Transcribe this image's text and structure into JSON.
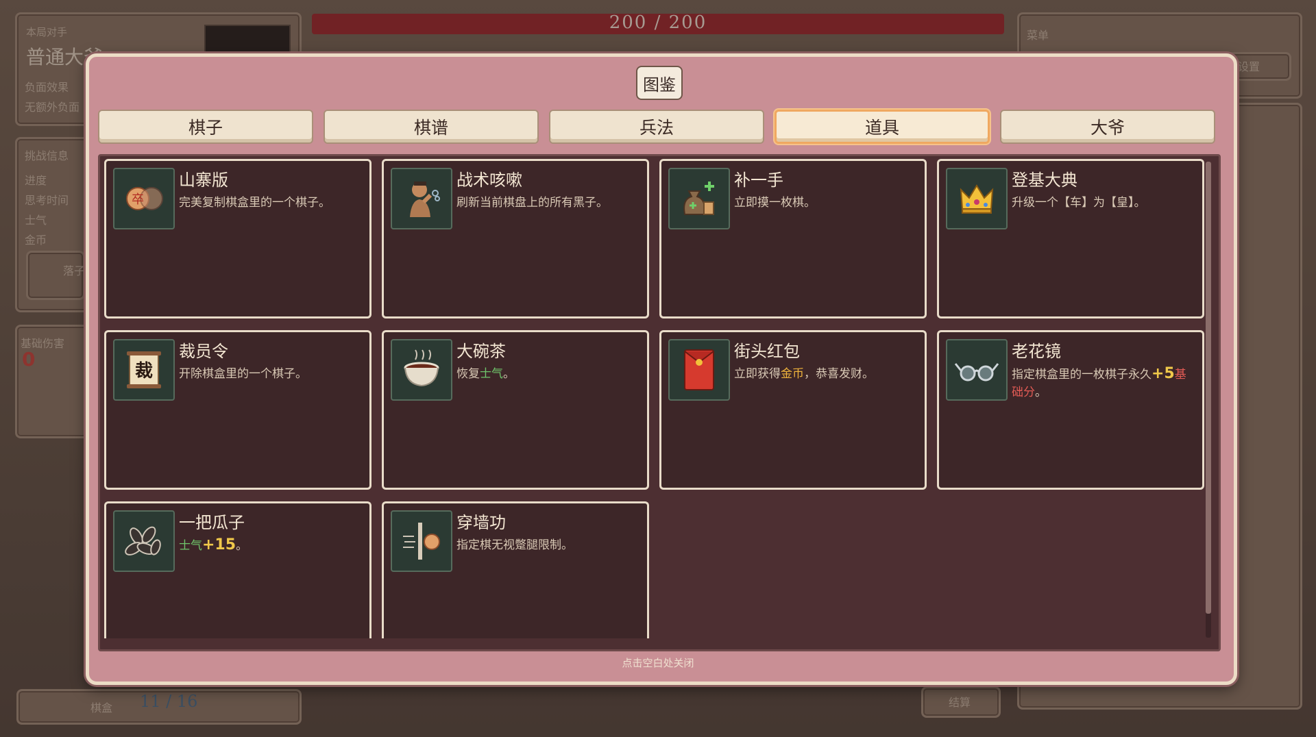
{
  "background": {
    "opponent_label": "本局对手",
    "opponent_name": "普通大爷",
    "negative_effects": "负面效果",
    "no_extra_effects": "无额外负面",
    "challenge_info": "挑战信息",
    "progress_label": "进度",
    "think_time_label": "思考时间",
    "morale_label": "士气",
    "gold_label": "金币",
    "drop_button": "落子",
    "base_damage_label": "基础伤害",
    "base_damage_value": "0",
    "hp_text": "200 / 200",
    "menu_label": "菜单",
    "menu_button": "设置",
    "board_label": "棋盒",
    "board_count": "11 / 16",
    "end_button": "结算"
  },
  "dialog": {
    "title": "图鉴",
    "tabs": [
      {
        "label": "棋子",
        "active": false
      },
      {
        "label": "棋谱",
        "active": false
      },
      {
        "label": "兵法",
        "active": false
      },
      {
        "label": "道具",
        "active": true
      },
      {
        "label": "大爷",
        "active": false
      }
    ],
    "items": [
      {
        "title": "山寨版",
        "icon": "copy-pawn-icon",
        "desc_parts": [
          {
            "t": "完美复制棋盒里的一个棋子。"
          }
        ]
      },
      {
        "title": "战术咳嗽",
        "icon": "coughing-man-icon",
        "desc_parts": [
          {
            "t": "刷新当前棋盘上的所有黑子。"
          }
        ]
      },
      {
        "title": "补一手",
        "icon": "money-bag-icon",
        "desc_parts": [
          {
            "t": "立即摸一枚棋。"
          }
        ]
      },
      {
        "title": "登基大典",
        "icon": "crown-icon",
        "desc_parts": [
          {
            "t": "升级一个【车】为【皇】。"
          }
        ]
      },
      {
        "title": "裁员令",
        "icon": "dismiss-scroll-icon",
        "icon_char": "裁",
        "desc_parts": [
          {
            "t": "开除棋盒里的一个棋子。"
          }
        ]
      },
      {
        "title": "大碗茶",
        "icon": "tea-bowl-icon",
        "desc_parts": [
          {
            "t": "恢复"
          },
          {
            "t": "士气",
            "c": "green"
          },
          {
            "t": "。"
          }
        ]
      },
      {
        "title": "街头红包",
        "icon": "red-envelope-icon",
        "desc_parts": [
          {
            "t": "立即获得"
          },
          {
            "t": "金币",
            "c": "gold"
          },
          {
            "t": "，恭喜发财。"
          }
        ]
      },
      {
        "title": "老花镜",
        "icon": "glasses-icon",
        "desc_parts": [
          {
            "t": "指定棋盒里的一枚棋子永久"
          },
          {
            "t": "+5",
            "c": "num"
          },
          {
            "t": "基础分",
            "c": "red"
          },
          {
            "t": "。"
          }
        ]
      },
      {
        "title": "一把瓜子",
        "icon": "sunflower-seeds-icon",
        "desc_parts": [
          {
            "t": "士气",
            "c": "green"
          },
          {
            "t": "+15",
            "c": "num"
          },
          {
            "t": "。"
          }
        ]
      },
      {
        "title": "穿墙功",
        "icon": "wall-pass-icon",
        "desc_parts": [
          {
            "t": "指定棋无视蹩腿限制。"
          }
        ]
      }
    ],
    "icon_pawn_char": "卒",
    "footer_hint": "点击空白处关闭"
  },
  "colors": {
    "dialog_bg": "#c98f95",
    "content_bg": "#4d2f32",
    "active_tab_border": "#f0a860",
    "hp_bar": "#9e2a2e",
    "highlight_green": "#6fc56b",
    "highlight_gold": "#f0b43c",
    "highlight_red": "#e25b55"
  }
}
